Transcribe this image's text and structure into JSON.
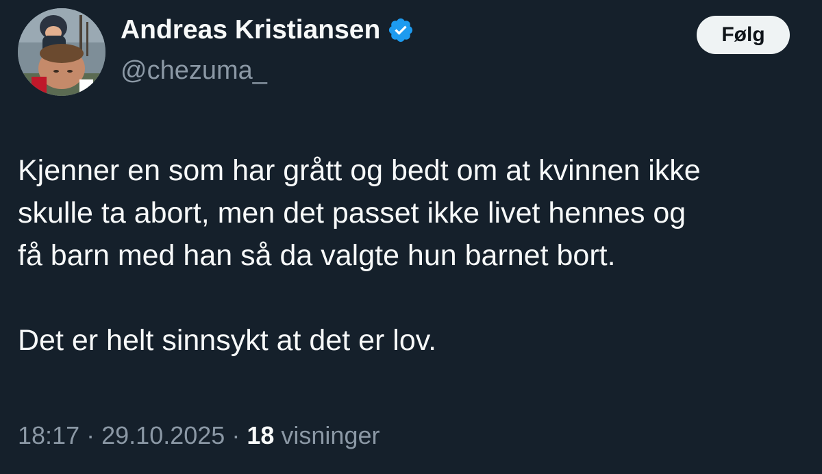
{
  "author": {
    "name": "Andreas Kristiansen",
    "handle": "@chezuma_",
    "verified": true,
    "verified_color": "#1d9bf0"
  },
  "follow_button": {
    "label": "Følg"
  },
  "tweet": {
    "lines": [
      "Kjenner en som har grått og bedt om at kvinnen ikke",
      "skulle ta abort, men det passet ikke livet hennes og",
      "få barn med han så da valgte hun barnet bort."
    ],
    "second_paragraph": "Det er helt sinnsykt at det er lov."
  },
  "meta": {
    "time": "18:17",
    "separator": "·",
    "date": "29.10.2025",
    "views_count": "18",
    "views_label": "visninger"
  },
  "colors": {
    "background": "#15202b",
    "text": "#f7f9f9",
    "secondary_text": "#8b98a5",
    "button_bg": "#eff3f4"
  }
}
